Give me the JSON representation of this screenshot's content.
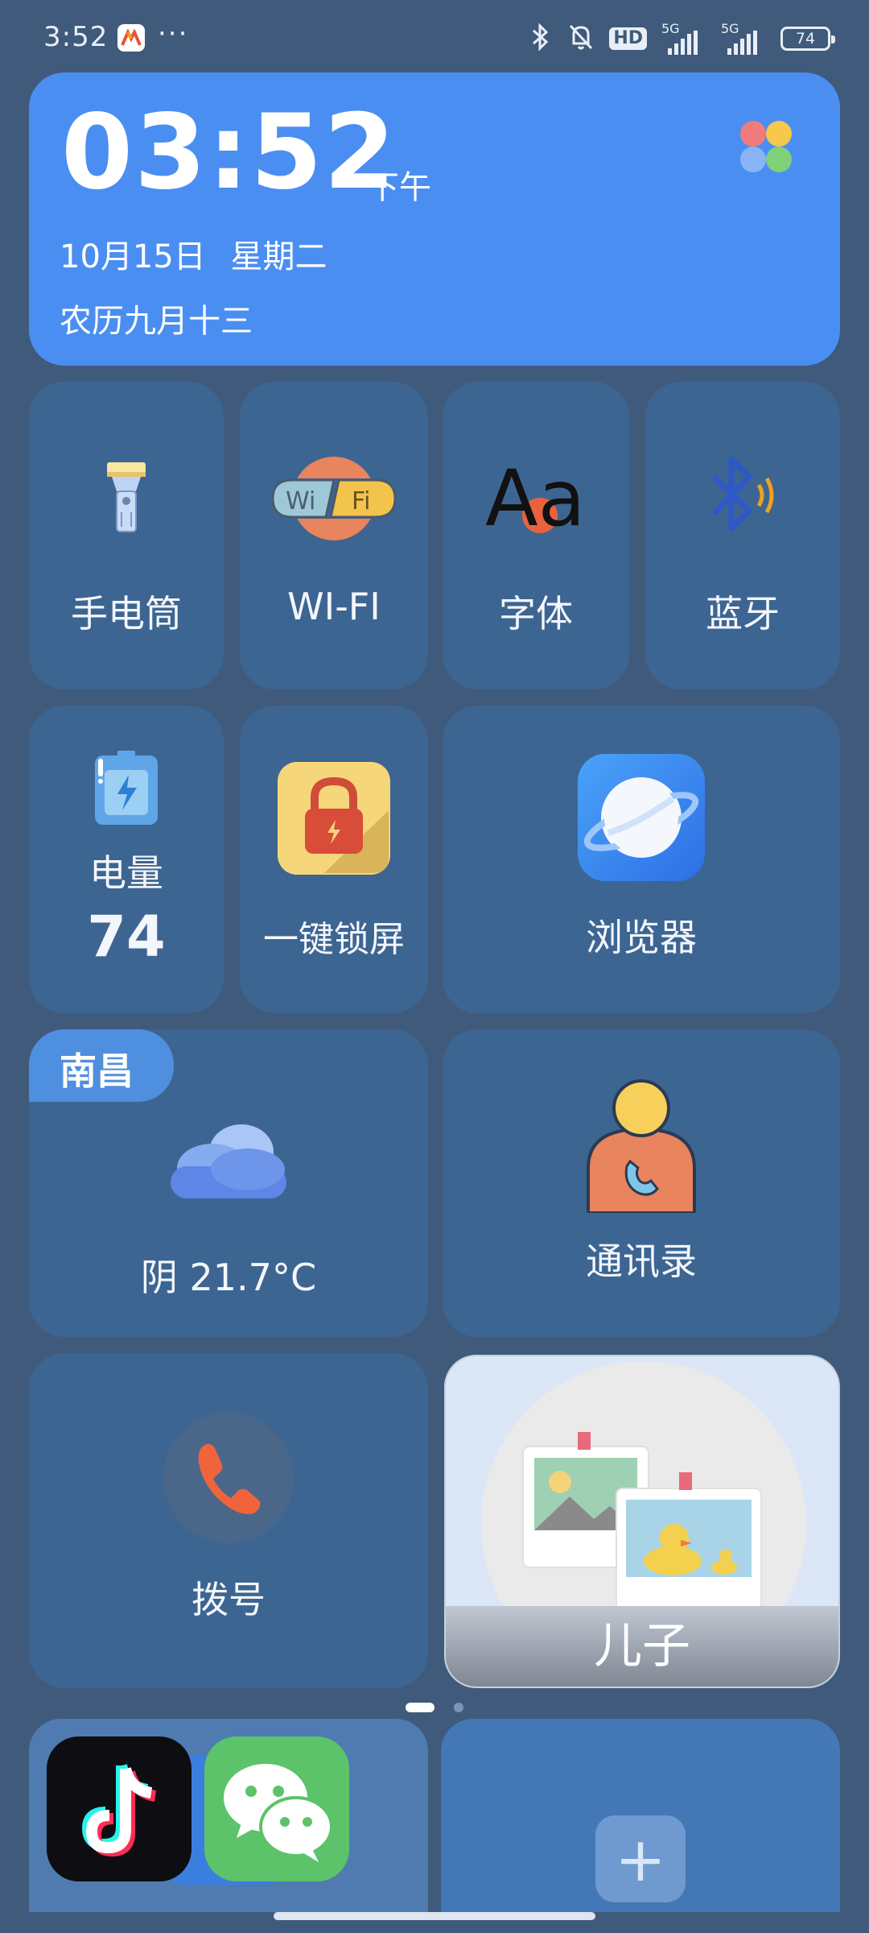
{
  "status_bar": {
    "time": "3:52",
    "more": "···",
    "hd": "HD",
    "signal1_label": "5G",
    "signal2_label": "5G",
    "battery": "74"
  },
  "clock": {
    "time": "03:52",
    "ampm": "下午",
    "date": "10月15日 星期二",
    "lunar": "农历九月十三"
  },
  "tiles": {
    "flashlight": "手电筒",
    "wifi": "WI-FI",
    "font": "字体",
    "bluetooth": "蓝牙",
    "battery_label": "电量",
    "battery_value": "74",
    "lock_screen": "一键锁屏",
    "browser": "浏览器",
    "weather_city": "南昌",
    "weather_text": "阴 21.7°C",
    "contacts": "通讯录",
    "dial": "拨号",
    "photo_label": "儿子"
  },
  "icons": {
    "wifi_left": "Wi",
    "wifi_right": "Fi",
    "font_glyph": "Aa"
  },
  "dock": {
    "add": "+"
  },
  "colors": {
    "background": "#3f5a7b",
    "clock_card": "#4b8ef2",
    "tile": "#3d6592",
    "accent_orange": "#e8623e"
  }
}
